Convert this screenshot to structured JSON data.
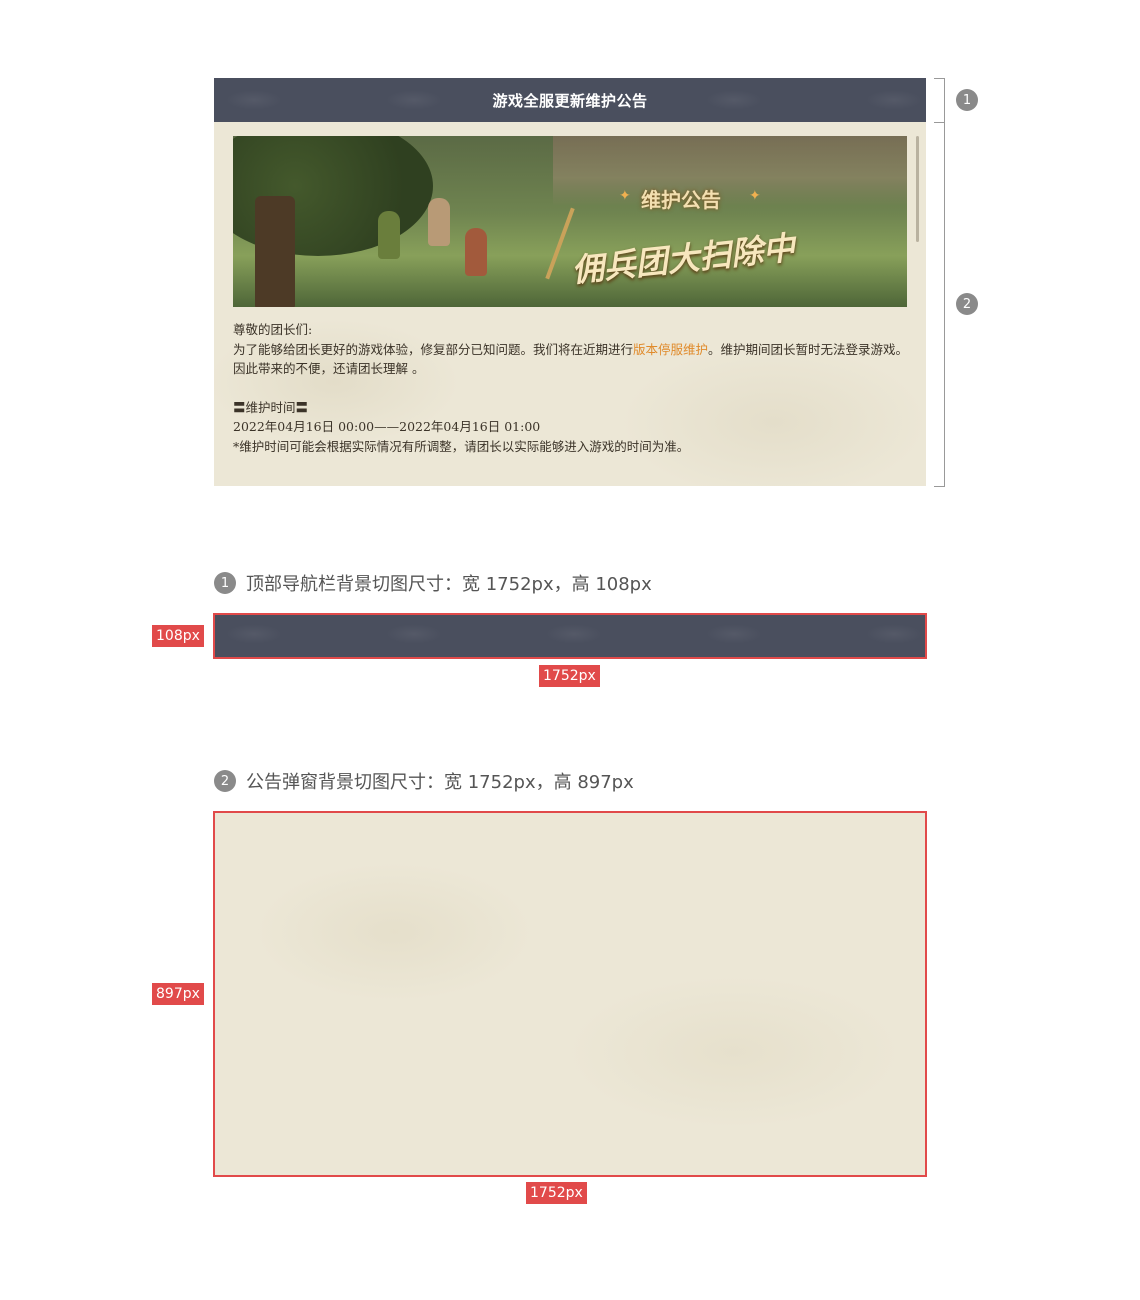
{
  "preview": {
    "nav_title": "游戏全服更新维护公告",
    "banner": {
      "subtitle": "维护公告",
      "title": "佣兵团大扫除中"
    },
    "content": {
      "greeting": "尊敬的团长们:",
      "line1_before": "为了能够给团长更好的游戏体验，修复部分已知问题。我们将在近期进行",
      "line1_highlight": "版本停服维护",
      "line1_after": "。维护期间团长暂时无法登录游戏。因此带来的不便，还请团长理解 。",
      "time_heading": "〓维护时间〓",
      "time_range": "2022年04月16日 00:00——2022年04月16日 01:00",
      "note": "*维护时间可能会根据实际情况有所调整，请团长以实际能够进入游戏的时间为准。"
    },
    "highlight_color": "#e08a2a",
    "markers": [
      "1",
      "2"
    ]
  },
  "spec": {
    "nav": {
      "badge": "1",
      "label": "顶部导航栏背景切图尺寸：宽 1752px，高 108px",
      "height_tag": "108px",
      "width_tag": "1752px"
    },
    "panel": {
      "badge": "2",
      "label": "公告弹窗背景切图尺寸：宽 1752px，高 897px",
      "height_tag": "897px",
      "width_tag": "1752px"
    }
  },
  "colors": {
    "nav_bg": "#4a4f5e",
    "panel_bg": "#ece7d6",
    "tag_red": "#e14a4a"
  }
}
